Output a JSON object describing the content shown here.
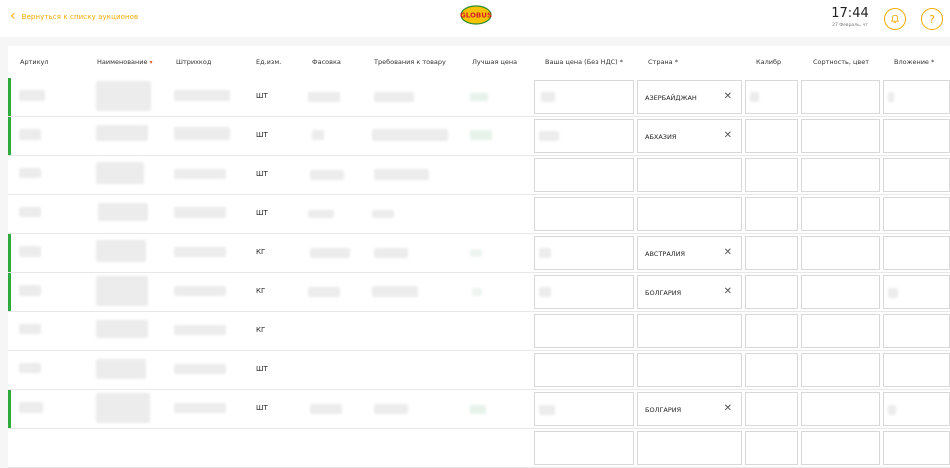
{
  "header": {
    "back_label": "Вернуться к списку аукционов",
    "logo_text": "GLOBUS",
    "time": "17:44",
    "date": "27 Февраль, чт",
    "help_label": "?"
  },
  "table": {
    "columns": [
      {
        "label": "Артикул"
      },
      {
        "label": "Наименование",
        "sort_icon": "▾"
      },
      {
        "label": "Штрихкод"
      },
      {
        "label": "Ед.изм."
      },
      {
        "label": "Фасовка"
      },
      {
        "label": "Требования к товару"
      },
      {
        "label": "Лучшая цена"
      },
      {
        "label": "Ваша цена (Без НДС) *"
      },
      {
        "label": "Страна *"
      },
      {
        "label": "Калибр"
      },
      {
        "label": "Сортность, цвет"
      },
      {
        "label": "Вложение *"
      }
    ],
    "rows": [
      {
        "unit": "ШТ",
        "country": "АЗЕРБАЙДЖАН",
        "active": true
      },
      {
        "unit": "ШТ",
        "country": "АБХАЗИЯ",
        "active": true
      },
      {
        "unit": "ШТ",
        "country": "",
        "active": false
      },
      {
        "unit": "ШТ",
        "country": "",
        "active": false
      },
      {
        "unit": "КГ",
        "country": "АВСТРАЛИЯ",
        "active": true
      },
      {
        "unit": "КГ",
        "country": "БОЛГАРИЯ",
        "active": true
      },
      {
        "unit": "КГ",
        "country": "",
        "active": false
      },
      {
        "unit": "ШТ",
        "country": "",
        "active": false
      },
      {
        "unit": "ШТ",
        "country": "БОЛГАРИЯ",
        "active": true
      }
    ]
  },
  "colors": {
    "accent": "#f2a900",
    "active_row": "#2eaa3c",
    "sort_arrow": "#f05a22"
  }
}
